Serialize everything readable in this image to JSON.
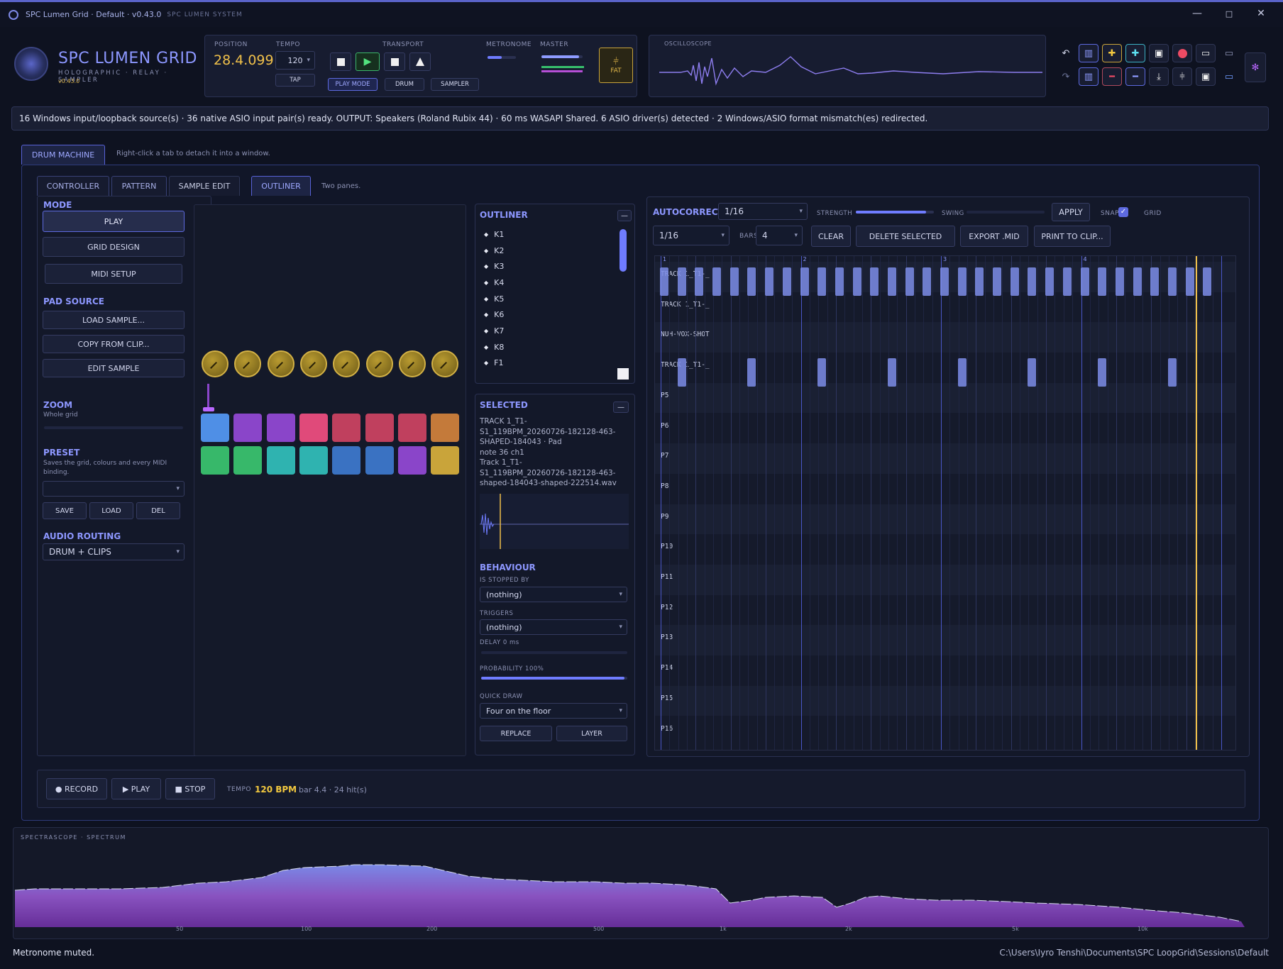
{
  "window": {
    "title": "SPC Lumen Grid · Default · v0.43.0",
    "subtitle": "SPC LUMEN SYSTEM"
  },
  "brand": {
    "name": "SPC LUMEN GRID",
    "tagline": "HOLOGRAPHIC · RELAY · SAMPLER",
    "version": "v0.43.0"
  },
  "transport": {
    "position_label": "POSITION",
    "position": "28.4.099",
    "tempo_label": "TEMPO",
    "tempo": "120",
    "tap": "TAP",
    "transport_label": "TRANSPORT",
    "play_mode": "PLAY MODE",
    "drum": "DRUM",
    "sampler": "SAMPLER",
    "metronome_label": "METRONOME",
    "master_label": "MASTER",
    "fat": "FAT"
  },
  "oscilloscope": {
    "label": "OSCILLOSCOPE"
  },
  "status": "16 Windows input/loopback source(s) · 36 native ASIO input pair(s) ready. OUTPUT: Speakers (Roland Rubix 44) · 60 ms WASAPI Shared. 6 ASIO driver(s) detected · 2 Windows/ASIO format mismatch(es) redirected.",
  "main_tabs": {
    "active": "DRUM MACHINE",
    "hint": "Right-click a tab to detach it into a window."
  },
  "sub_tabs": {
    "controller": "CONTROLLER",
    "pattern": "PATTERN",
    "sample_edit": "SAMPLE EDIT",
    "outliner": "OUTLINER",
    "hint": "Two panes."
  },
  "left": {
    "mode": "MODE",
    "play": "PLAY",
    "grid_design": "GRID DESIGN",
    "midi_setup": "MIDI SETUP",
    "pad_source": "PAD SOURCE",
    "load_sample": "LOAD SAMPLE...",
    "copy_from_clip": "COPY FROM CLIP...",
    "edit_sample": "EDIT SAMPLE",
    "zoom": "ZOOM",
    "zoom_sub": "Whole grid",
    "preset": "PRESET",
    "preset_sub": "Saves the grid, colours and every MIDI binding.",
    "save": "SAVE",
    "load": "LOAD",
    "del": "DEL",
    "audio_routing": "AUDIO ROUTING",
    "routing_value": "DRUM + CLIPS"
  },
  "pads": {
    "row1": [
      "#4f8fe6",
      "#8a45c9",
      "#8a45c9",
      "#e04a7a",
      "#c0405e",
      "#c0405e",
      "#c0405e",
      "#c47a3a"
    ],
    "row2": [
      "#37b86a",
      "#37b86a",
      "#2fb3b0",
      "#2fb3b0",
      "#3a72c2",
      "#3a72c2",
      "#8a45c9",
      "#c9a43a"
    ]
  },
  "outliner": {
    "title": "OUTLINER",
    "items": [
      "K1",
      "K2",
      "K3",
      "K4",
      "K5",
      "K6",
      "K7",
      "K8",
      "F1"
    ]
  },
  "selected": {
    "title": "SELECTED",
    "lines": [
      "TRACK 1_T1-",
      "S1_119BPM_20260726-182128-463-",
      "SHAPED-184043 · Pad",
      "note 36 ch1",
      "Track 1_T1-",
      "S1_119BPM_20260726-182128-463-",
      "shaped-184043-shaped-222514.wav"
    ]
  },
  "behaviour": {
    "title": "BEHAVIOUR",
    "stopped_by_label": "IS STOPPED BY",
    "stopped_by": "(nothing)",
    "triggers_label": "TRIGGERS",
    "triggers": "(nothing)",
    "delay": "DELAY 0 ms",
    "probability": "PROBABILITY 100%",
    "probability_value": 0.98,
    "quick_draw_label": "QUICK DRAW",
    "quick_draw": "Four on the floor",
    "replace": "REPLACE",
    "layer": "LAYER"
  },
  "autocorrect": {
    "title": "AUTOCORRECT",
    "value": "1/16",
    "strength_label": "STRENGTH",
    "strength": 0.9,
    "swing_label": "SWING",
    "swing": 0,
    "apply": "APPLY",
    "snap": "SNAP",
    "grid": "GRID",
    "grid_value": "1/16",
    "bars_label": "BARS",
    "bars": "4",
    "clear": "CLEAR",
    "delete_selected": "DELETE SELECTED",
    "export_mid": "EXPORT .MID",
    "print_to_clip": "PRINT TO CLIP..."
  },
  "piano_roll": {
    "bar_markers": [
      "1",
      "2",
      "3",
      "4"
    ],
    "rows": [
      "TRACK 1_T1-_",
      "TRACK 1_T1-_",
      "NUH-VOX-SHOT",
      "TRACK 1_T1-_",
      "P5",
      "P6",
      "P7",
      "P8",
      "P9",
      "P10",
      "P11",
      "P12",
      "P13",
      "P14",
      "P15",
      "P16"
    ]
  },
  "bottom": {
    "record": "● RECORD",
    "play": "▶ PLAY",
    "stop": "■ STOP",
    "tempo_label": "TEMPO",
    "tempo": "120 BPM",
    "bar_info": "bar 4.4 · 24 hit(s)"
  },
  "spectrum": {
    "label": "SPECTRASCOPE · SPECTRUM",
    "ticks": [
      "50",
      "100",
      "200",
      "500",
      "1k",
      "2k",
      "5k",
      "10k"
    ]
  },
  "footer": {
    "left": "Metronome muted.",
    "right": "C:\\Users\\Iyro Tenshi\\Documents\\SPC LoopGrid\\Sessions\\Default"
  }
}
